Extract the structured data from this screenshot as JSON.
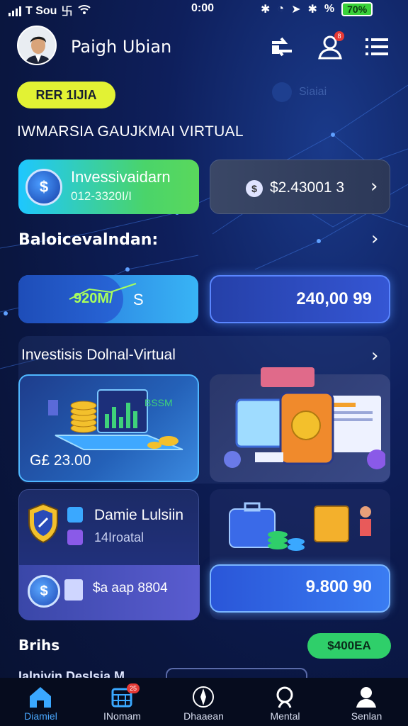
{
  "status_bar": {
    "carrier": "T Sou",
    "carrier_extra": "࿕",
    "time": "0:00",
    "right_text": "%",
    "battery": "70%"
  },
  "header": {
    "user_name": "Paigh Ubian",
    "notification_count": "8"
  },
  "tag_pill": "RER 1IJIA",
  "faint_label": "Siaiai",
  "section_title": "IWMARSIA GAUJKMAI VIRTUAL",
  "invest_card": {
    "title": "Invessivaidarn",
    "subtitle": "012-3320I/I",
    "icon": "dollar-coin-icon"
  },
  "balance_card": {
    "value": "$2.43001 3"
  },
  "balance_section": {
    "title": "Baloicevalndan:"
  },
  "stat_left": {
    "value": "920M/",
    "suffix": "S"
  },
  "stat_right": {
    "value": "240,00 99"
  },
  "investments": {
    "title": "Investisis Dolnal-Virtual",
    "left_amount": "G£ 23.00",
    "left_chart_label": "BSSM"
  },
  "daily_card": {
    "title": "Damie Lulsiin",
    "subtitle": "14Iroatal",
    "amount": "$a aap 8804"
  },
  "right_card": {
    "value": "9.800 90"
  },
  "footer_row": {
    "label": "Brihs",
    "button": "$400EA",
    "cut_text": "Ialnivin Deslsia M"
  },
  "tabs": [
    {
      "label": "Diamiel",
      "icon": "home-icon",
      "active": true
    },
    {
      "label": "INomam",
      "icon": "calendar-icon",
      "badge": "25"
    },
    {
      "label": "Dhaaean",
      "icon": "compass-icon"
    },
    {
      "label": "Mental",
      "icon": "search-icon"
    },
    {
      "label": "Senlan",
      "icon": "profile-icon"
    }
  ],
  "colors": {
    "accent_yellow": "#e2f234",
    "accent_green": "#2fcf6a",
    "primary_blue": "#3a7cf2",
    "background": "#0e1f5c"
  }
}
